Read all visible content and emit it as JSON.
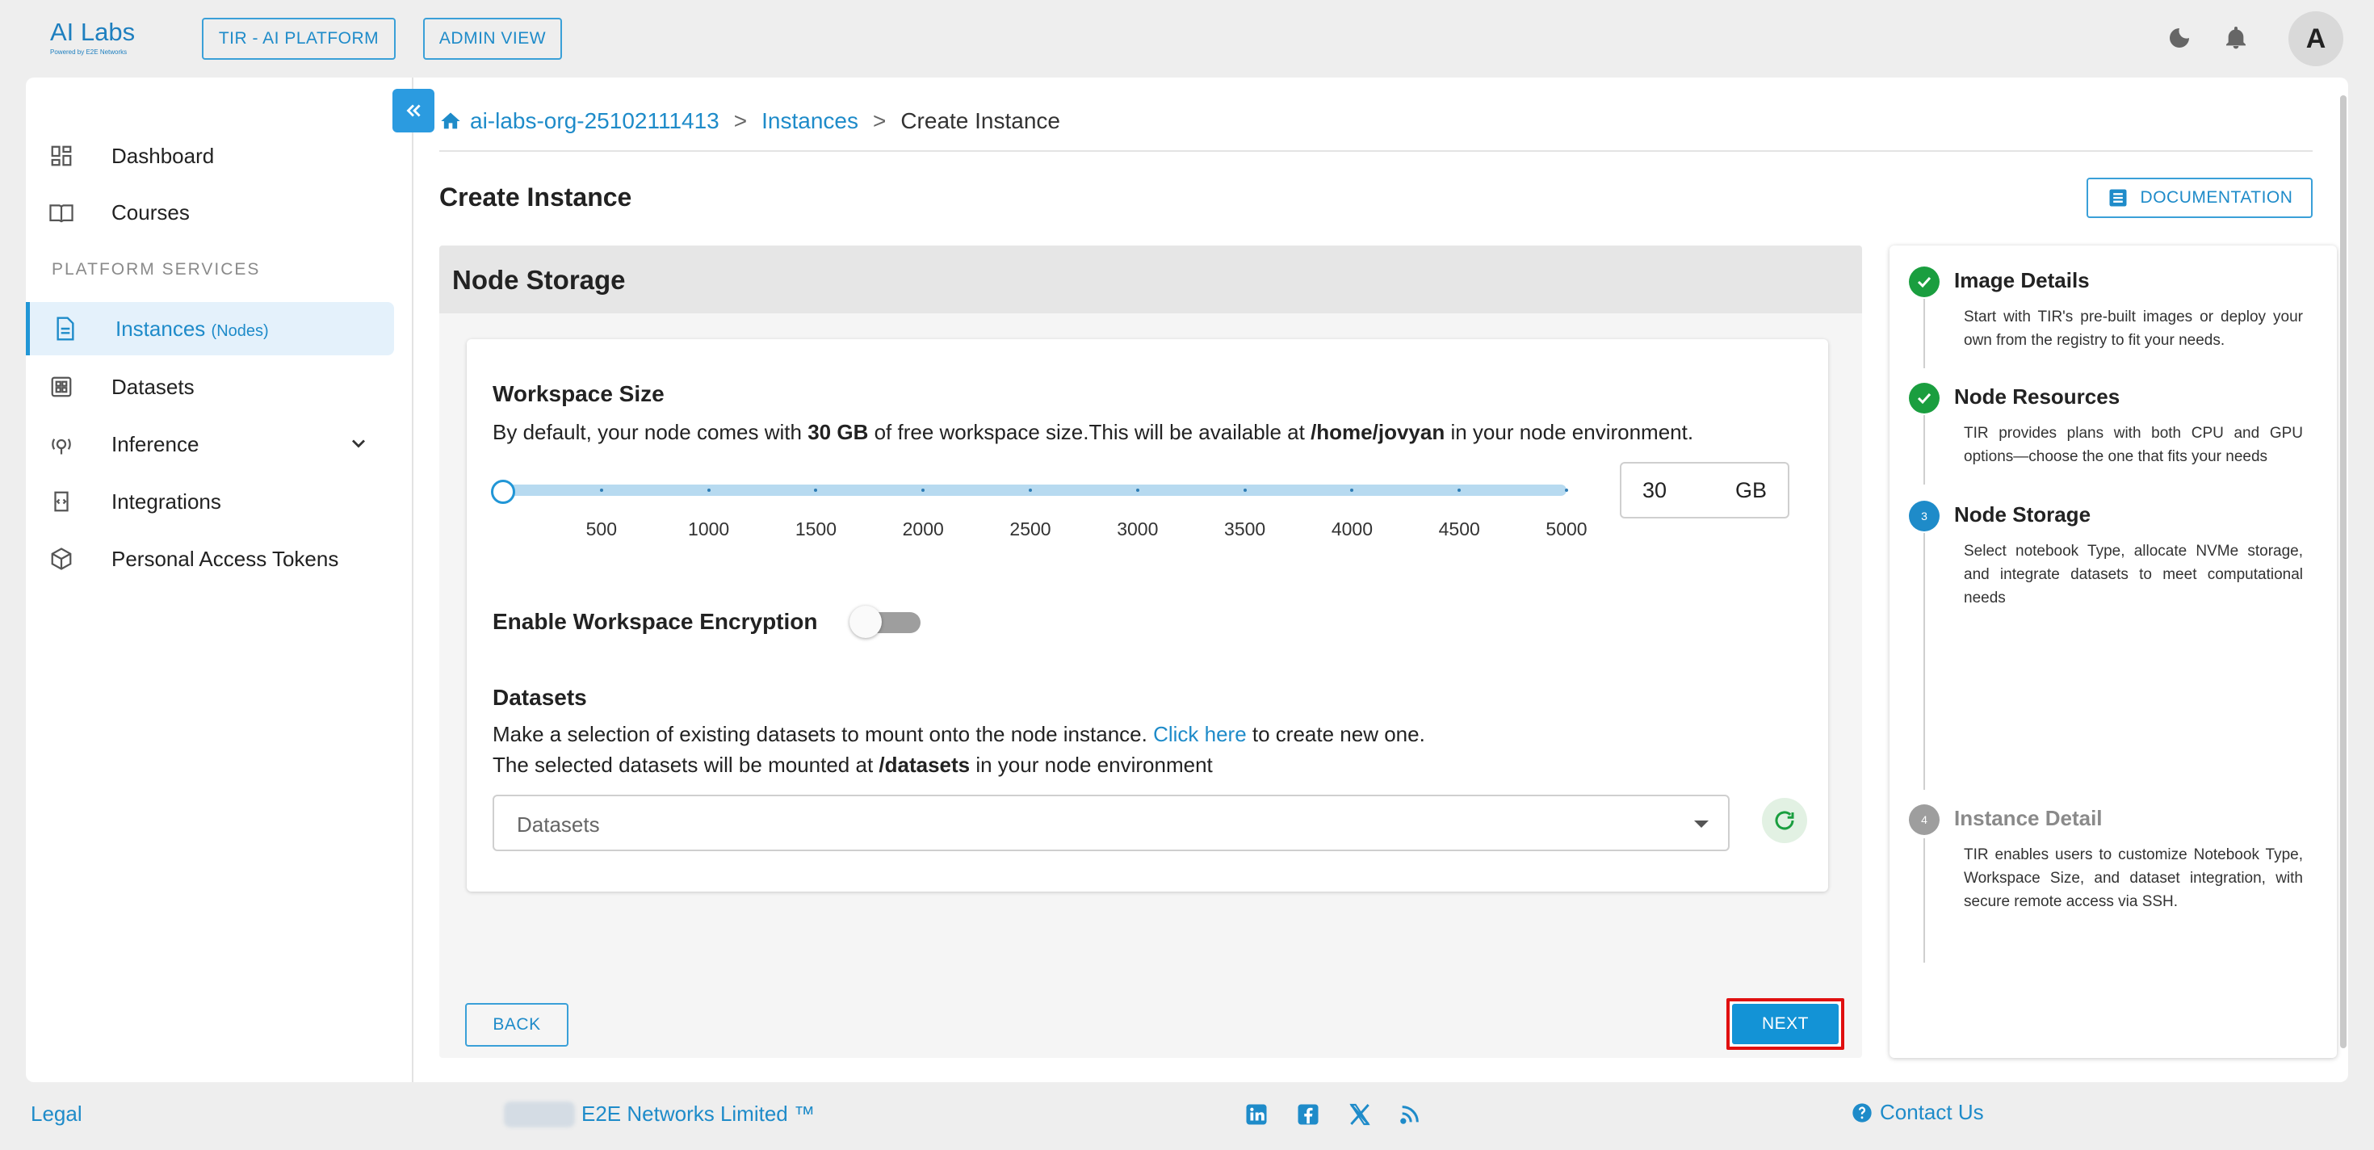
{
  "header": {
    "logo_text": "AI Labs",
    "logo_tagline": "Powered by E2E Networks",
    "platform_button": "TIR - AI PLATFORM",
    "admin_button": "ADMIN VIEW",
    "avatar_letter": "A"
  },
  "sidebar": {
    "items": [
      {
        "label": "Dashboard",
        "icon": "dashboard-icon"
      },
      {
        "label": "Courses",
        "icon": "book-icon"
      }
    ],
    "section_label": "PLATFORM SERVICES",
    "services": [
      {
        "label": "Instances",
        "sub": "(Nodes)",
        "icon": "document-icon",
        "active": true
      },
      {
        "label": "Datasets",
        "icon": "grid-icon"
      },
      {
        "label": "Inference",
        "icon": "inference-icon"
      },
      {
        "label": "Integrations",
        "icon": "code-icon"
      },
      {
        "label": "Personal Access Tokens",
        "icon": "token-icon"
      }
    ]
  },
  "breadcrumb": {
    "org": "ai-labs-org-25102111413",
    "sep": ">",
    "instances": "Instances",
    "current": "Create Instance"
  },
  "page": {
    "title": "Create Instance",
    "documentation_button": "DOCUMENTATION"
  },
  "form": {
    "panel_title": "Node Storage",
    "workspace": {
      "title": "Workspace Size",
      "desc_prefix": "By default, your node comes with ",
      "desc_size": "30 GB",
      "desc_mid": " of free workspace size.This will be available at ",
      "desc_path": "/home/jovyan",
      "desc_suffix": " in your node environment.",
      "slider_ticks": [
        "500",
        "1000",
        "1500",
        "2000",
        "2500",
        "3000",
        "3500",
        "4000",
        "4500",
        "5000"
      ],
      "slider_min": 30,
      "slider_max": 5000,
      "value": "30",
      "unit": "GB"
    },
    "encryption": {
      "label": "Enable Workspace Encryption",
      "enabled": false
    },
    "datasets": {
      "title": "Datasets",
      "desc_prefix": "Make a selection of existing datasets to mount onto the node instance. ",
      "link": "Click here",
      "desc_suffix": " to create new one.",
      "mount_prefix": "The selected datasets will be mounted at ",
      "mount_path": "/datasets",
      "mount_suffix": " in your node environment",
      "placeholder": "Datasets"
    },
    "back_button": "BACK",
    "next_button": "NEXT"
  },
  "steps": [
    {
      "num": "1",
      "title": "Image Details",
      "desc": "Start with TIR's pre-built images or deploy your own from the registry to fit your needs.",
      "status": "done"
    },
    {
      "num": "2",
      "title": "Node Resources",
      "desc": "TIR provides plans with both CPU and GPU options—choose the one that fits your needs",
      "status": "done"
    },
    {
      "num": "3",
      "title": "Node Storage",
      "desc": "Select notebook Type, allocate NVMe storage, and integrate datasets to meet computational needs",
      "status": "active"
    },
    {
      "num": "4",
      "title": "Instance Detail",
      "desc": "TIR enables users to customize Notebook Type, Workspace Size, and dataset integration, with secure remote access via SSH.",
      "status": "pending"
    }
  ],
  "footer": {
    "legal": "Legal",
    "company": "E2E Networks Limited ™",
    "contact": "Contact Us"
  },
  "colors": {
    "accent": "#1e8bc9",
    "success": "#1a9e3f",
    "highlight": "#e01010"
  }
}
